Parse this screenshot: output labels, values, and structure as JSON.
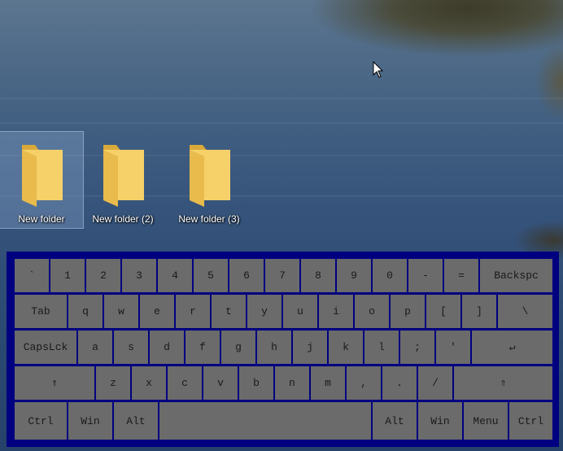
{
  "desktop": {
    "icons": [
      {
        "label": "New folder",
        "icon": "folder-icon",
        "selected": true
      },
      {
        "label": "New folder (2)",
        "icon": "folder-icon",
        "selected": false
      },
      {
        "label": "New folder (3)",
        "icon": "folder-icon",
        "selected": false
      }
    ]
  },
  "keyboard": {
    "colors": {
      "frame": "#000080",
      "key": "#6b6b6b",
      "text": "#1a1a1a"
    },
    "rows": [
      [
        "`",
        "1",
        "2",
        "3",
        "4",
        "5",
        "6",
        "7",
        "8",
        "9",
        "0",
        "-",
        "=",
        "Backspc"
      ],
      [
        "Tab",
        "q",
        "w",
        "e",
        "r",
        "t",
        "y",
        "u",
        "i",
        "o",
        "p",
        "[",
        "]",
        "\\"
      ],
      [
        "CapsLck",
        "a",
        "s",
        "d",
        "f",
        "g",
        "h",
        "j",
        "k",
        "l",
        ";",
        "'",
        "↵"
      ],
      [
        "⇑",
        "z",
        "x",
        "c",
        "v",
        "b",
        "n",
        "m",
        ",",
        ".",
        "/",
        "⇑"
      ],
      [
        "Ctrl",
        "Win",
        "Alt",
        "",
        "Alt",
        "Win",
        "Menu",
        "Ctrl"
      ]
    ]
  }
}
